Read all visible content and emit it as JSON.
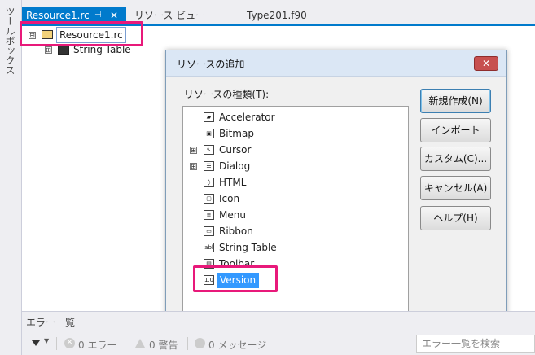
{
  "toolbox": {
    "label": "ツールボックス"
  },
  "tabs": {
    "active": {
      "label": "Resource1.rc",
      "pin": "⊣",
      "close": "✕"
    },
    "second": {
      "label": "リソース ビュー"
    },
    "third": {
      "label": "Type201.f90"
    }
  },
  "tree": {
    "root": {
      "label": "Resource1.rc",
      "expander": "⊟"
    },
    "child": {
      "label": "String Table",
      "expander": "⊞"
    }
  },
  "dialog": {
    "title": "リソースの追加",
    "close": "✕",
    "type_label": "リソースの種類(T):",
    "items": [
      {
        "label": "Accelerator",
        "icon": "accelerator-icon",
        "glyph": "▰",
        "expandable": false
      },
      {
        "label": "Bitmap",
        "icon": "bitmap-icon",
        "glyph": "▣",
        "expandable": false
      },
      {
        "label": "Cursor",
        "icon": "cursor-icon",
        "glyph": "↖",
        "expandable": true
      },
      {
        "label": "Dialog",
        "icon": "dialog-icon",
        "glyph": "☰",
        "expandable": true
      },
      {
        "label": "HTML",
        "icon": "html-icon",
        "glyph": "◊",
        "expandable": false
      },
      {
        "label": "Icon",
        "icon": "icon-resource-icon",
        "glyph": "▢",
        "expandable": false
      },
      {
        "label": "Menu",
        "icon": "menu-icon",
        "glyph": "≡",
        "expandable": false
      },
      {
        "label": "Ribbon",
        "icon": "ribbon-icon",
        "glyph": "▭",
        "expandable": false
      },
      {
        "label": "String Table",
        "icon": "string-table-icon",
        "glyph": "abl",
        "expandable": false
      },
      {
        "label": "Toolbar",
        "icon": "toolbar-icon",
        "glyph": "▤",
        "expandable": false
      },
      {
        "label": "Version",
        "icon": "version-icon",
        "glyph": "1.0",
        "expandable": false,
        "selected": true
      }
    ],
    "buttons": {
      "new": "新規作成(N)",
      "import": "インポート(M)...",
      "custom": "カスタム(C)...",
      "cancel": "キャンセル(A)",
      "help": "ヘルプ(H)"
    }
  },
  "error_list": {
    "title": "エラー一覧",
    "errors": "0 エラー",
    "warnings": "0 警告",
    "messages": "0 メッセージ",
    "search_placeholder": "エラー一覧を検索"
  },
  "colors": {
    "accent": "#007acc",
    "highlight": "#e8197a",
    "selection": "#3399ff"
  }
}
